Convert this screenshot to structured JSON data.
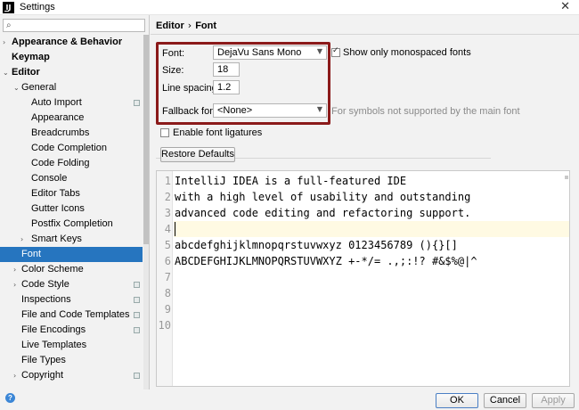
{
  "window": {
    "title": "Settings",
    "app_icon_text": "IJ"
  },
  "search": {
    "placeholder": "",
    "value": ""
  },
  "tree": [
    {
      "label": "Appearance & Behavior",
      "bold": true,
      "arrow": "›",
      "indent": 0
    },
    {
      "label": "Keymap",
      "bold": true,
      "arrow": "",
      "indent": 0
    },
    {
      "label": "Editor",
      "bold": true,
      "arrow": "⌄",
      "indent": 0
    },
    {
      "label": "General",
      "bold": false,
      "arrow": "⌄",
      "indent": 1
    },
    {
      "label": "Auto Import",
      "bold": false,
      "arrow": "",
      "indent": 2,
      "copy": true
    },
    {
      "label": "Appearance",
      "bold": false,
      "arrow": "",
      "indent": 2
    },
    {
      "label": "Breadcrumbs",
      "bold": false,
      "arrow": "",
      "indent": 2
    },
    {
      "label": "Code Completion",
      "bold": false,
      "arrow": "",
      "indent": 2
    },
    {
      "label": "Code Folding",
      "bold": false,
      "arrow": "",
      "indent": 2
    },
    {
      "label": "Console",
      "bold": false,
      "arrow": "",
      "indent": 2
    },
    {
      "label": "Editor Tabs",
      "bold": false,
      "arrow": "",
      "indent": 2
    },
    {
      "label": "Gutter Icons",
      "bold": false,
      "arrow": "",
      "indent": 2
    },
    {
      "label": "Postfix Completion",
      "bold": false,
      "arrow": "",
      "indent": 2
    },
    {
      "label": "Smart Keys",
      "bold": false,
      "arrow": "›",
      "indent": 2
    },
    {
      "label": "Font",
      "bold": false,
      "arrow": "",
      "indent": 1,
      "selected": true
    },
    {
      "label": "Color Scheme",
      "bold": false,
      "arrow": "›",
      "indent": 1
    },
    {
      "label": "Code Style",
      "bold": false,
      "arrow": "›",
      "indent": 1,
      "copy": true
    },
    {
      "label": "Inspections",
      "bold": false,
      "arrow": "",
      "indent": 1,
      "copy": true
    },
    {
      "label": "File and Code Templates",
      "bold": false,
      "arrow": "",
      "indent": 1,
      "copy": true
    },
    {
      "label": "File Encodings",
      "bold": false,
      "arrow": "",
      "indent": 1,
      "copy": true
    },
    {
      "label": "Live Templates",
      "bold": false,
      "arrow": "",
      "indent": 1
    },
    {
      "label": "File Types",
      "bold": false,
      "arrow": "",
      "indent": 1
    },
    {
      "label": "Copyright",
      "bold": false,
      "arrow": "›",
      "indent": 1,
      "copy": true
    }
  ],
  "breadcrumb": {
    "parent": "Editor",
    "separator": "›",
    "current": "Font"
  },
  "form": {
    "font_label": "Font:",
    "font_value": "DejaVu Sans Mono",
    "mono_only_label": "Show only monospaced fonts",
    "mono_only_checked": true,
    "size_label": "Size:",
    "size_value": "18",
    "line_spacing_label": "Line spacing:",
    "line_spacing_value": "1.2",
    "fallback_label": "Fallback font:",
    "fallback_value": "<None>",
    "fallback_hint": "For symbols not supported by the main font",
    "ligatures_label": "Enable font ligatures",
    "ligatures_checked": false,
    "restore_label": "Restore Defaults"
  },
  "preview": {
    "lines": [
      {
        "n": "1",
        "text": "IntelliJ IDEA is a full-featured IDE"
      },
      {
        "n": "2",
        "text": "with a high level of usability and outstanding"
      },
      {
        "n": "3",
        "text": "advanced code editing and refactoring support."
      },
      {
        "n": "4",
        "text": ""
      },
      {
        "n": "5",
        "text": "abcdefghijklmnopqrstuvwxyz 0123456789 (){}[]"
      },
      {
        "n": "6",
        "text": "ABCDEFGHIJKLMNOPQRSTUVWXYZ +-*/= .,;:!? #&$%@|^"
      },
      {
        "n": "7",
        "text": ""
      },
      {
        "n": "8",
        "text": ""
      },
      {
        "n": "9",
        "text": ""
      },
      {
        "n": "10",
        "text": ""
      }
    ]
  },
  "footer": {
    "ok_label": "OK",
    "cancel_label": "Cancel",
    "apply_label": "Apply",
    "help_icon": "?"
  },
  "colors": {
    "selection": "#2675bf",
    "highlight_border": "#8b1a1a"
  }
}
